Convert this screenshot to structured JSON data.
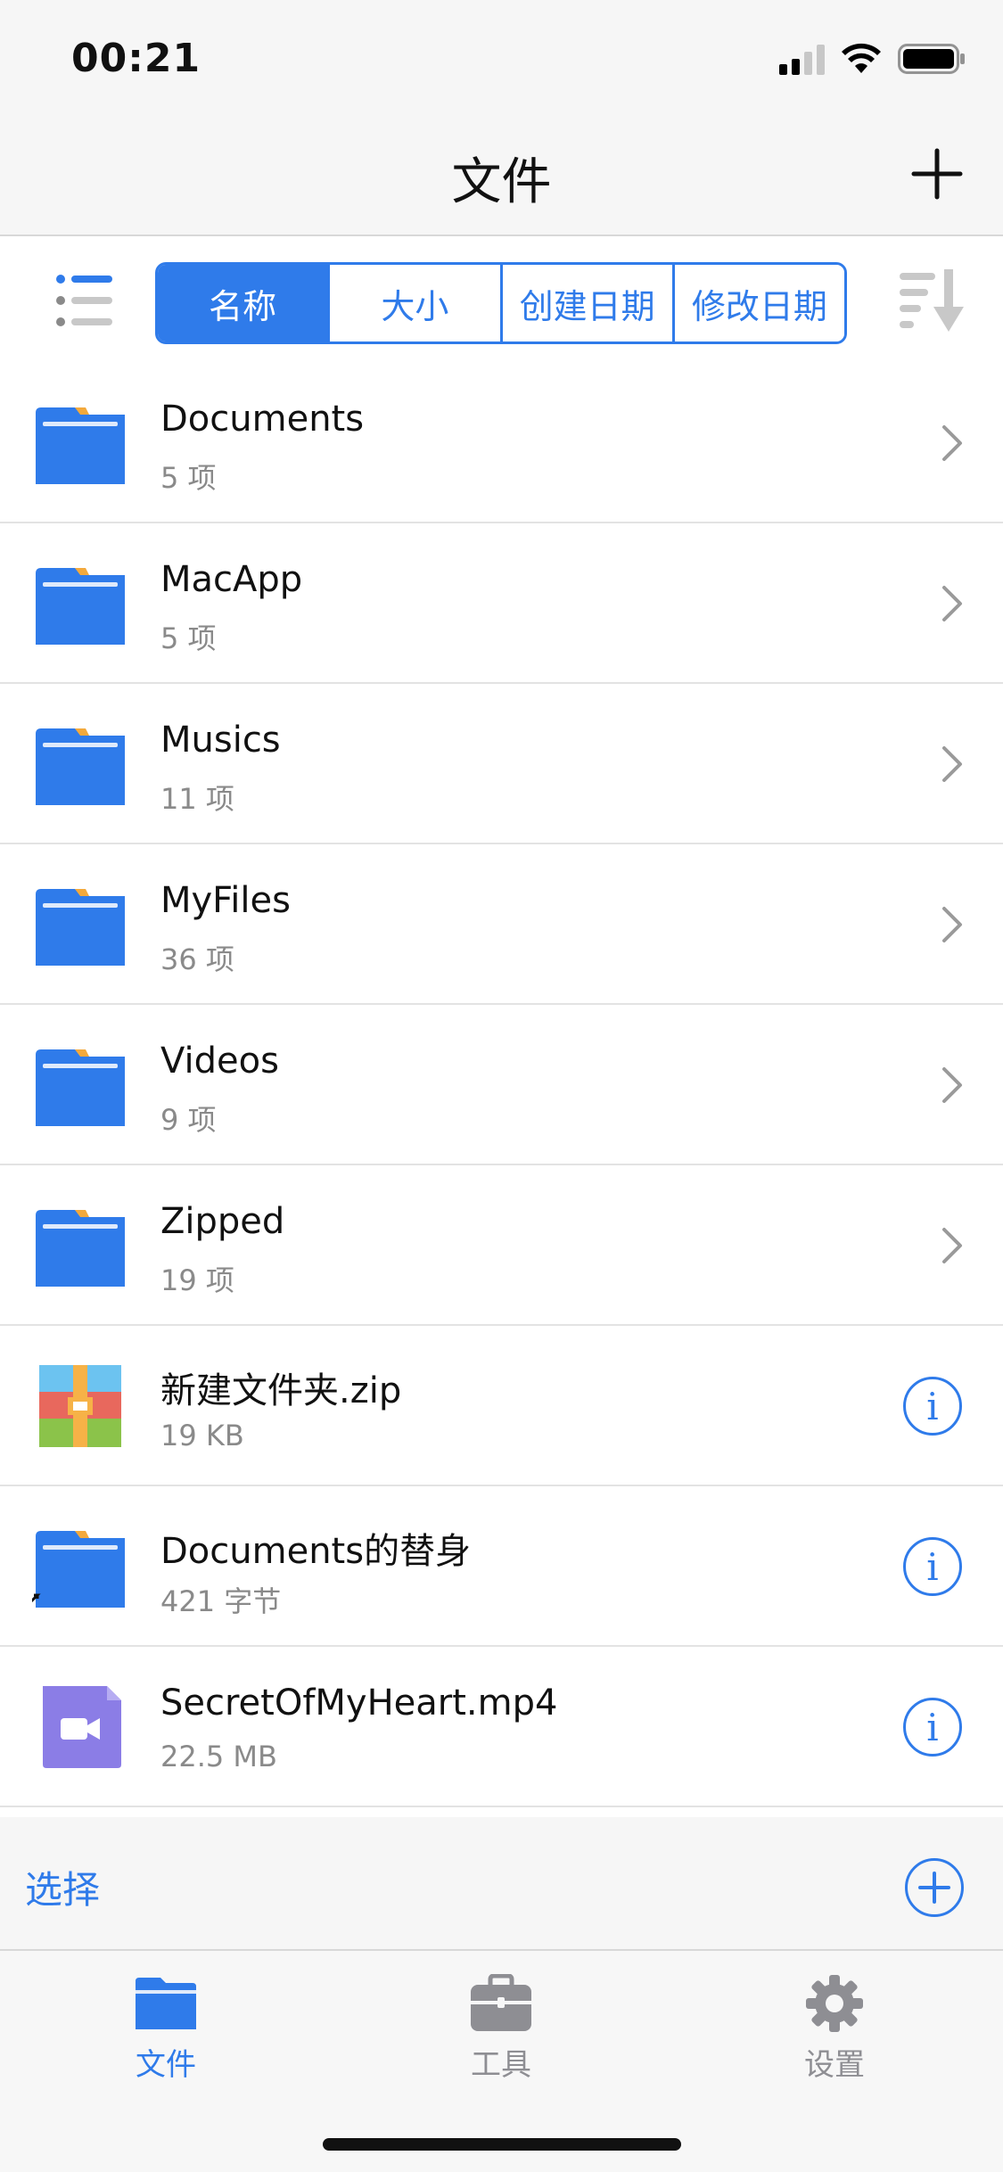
{
  "status_bar": {
    "time": "00:21"
  },
  "nav": {
    "title": "文件"
  },
  "sort_tabs": [
    "名称",
    "大小",
    "创建日期",
    "修改日期"
  ],
  "active_sort": 0,
  "files": [
    {
      "name": "Documents",
      "detail": "5 项",
      "kind": "folder",
      "action": "chevron"
    },
    {
      "name": "MacApp",
      "detail": "5 项",
      "kind": "folder",
      "action": "chevron"
    },
    {
      "name": "Musics",
      "detail": "11 项",
      "kind": "folder",
      "action": "chevron"
    },
    {
      "name": "MyFiles",
      "detail": "36 项",
      "kind": "folder",
      "action": "chevron"
    },
    {
      "name": "Videos",
      "detail": "9 项",
      "kind": "folder",
      "action": "chevron"
    },
    {
      "name": "Zipped",
      "detail": "19 项",
      "kind": "folder",
      "action": "chevron"
    },
    {
      "name": "新建文件夹.zip",
      "detail": "19 KB",
      "kind": "zip",
      "action": "info"
    },
    {
      "name": "Documents的替身",
      "detail": "421 字节",
      "kind": "alias",
      "action": "info"
    },
    {
      "name": "SecretOfMyHeart.mp4",
      "detail": "22.5 MB",
      "kind": "video",
      "action": "info"
    }
  ],
  "select_bar": {
    "label": "选择"
  },
  "tabs": [
    {
      "label": "文件",
      "icon": "folder-icon",
      "active": true
    },
    {
      "label": "工具",
      "icon": "toolbox-icon",
      "active": false
    },
    {
      "label": "设置",
      "icon": "gear-icon",
      "active": false
    }
  ],
  "colors": {
    "accent": "#2f7bea",
    "secondary_text": "#8a8a8a"
  }
}
